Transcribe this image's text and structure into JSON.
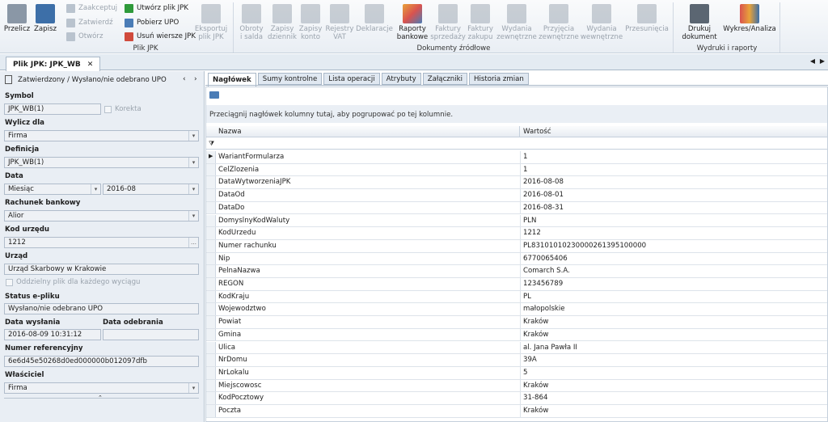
{
  "ribbon": {
    "buttons": [
      {
        "id": "przelicz",
        "label": "Przelicz",
        "enabled": true
      },
      {
        "id": "zapisz",
        "label": "Zapisz",
        "enabled": true
      }
    ],
    "plik_small": {
      "zaakceptuj": "Zaakceptuj",
      "zatwierdz": "Zatwierdź",
      "otworz": "Otwórz",
      "utworz": "Utwórz plik JPK",
      "pobierz": "Pobierz UPO",
      "usun": "Usuń wiersze JPK"
    },
    "eksport": [
      "Eksportuj",
      "plik JPK"
    ],
    "zrodlowe": [
      [
        "Obroty",
        "i salda"
      ],
      [
        "Zapisy",
        "dziennik"
      ],
      [
        "Zapisy",
        "konto"
      ],
      [
        "Rejestry",
        "VAT"
      ],
      [
        "Deklaracje",
        ""
      ],
      [
        "Raporty",
        "bankowe"
      ],
      [
        "Faktury",
        "sprzedaży"
      ],
      [
        "Faktury",
        "zakupu"
      ],
      [
        "Wydania",
        "zewnętrzne"
      ],
      [
        "Przyjęcia",
        "zewnętrzne"
      ],
      [
        "Wydania",
        "wewnętrzne"
      ],
      [
        "Przesunięcia",
        ""
      ]
    ],
    "drukuj": [
      "Drukuj",
      "dokument"
    ],
    "wykres": "Wykres/Analiza",
    "groups": {
      "plik": "Plik JPK",
      "zrodlowe": "Dokumenty źródłowe",
      "wydruki": "Wydruki i raporty"
    }
  },
  "doc_tab": {
    "label": "Plik JPK: JPK_WB",
    "close": "✕"
  },
  "left": {
    "status_header": "Zatwierdzony / Wysłano/nie odebrano UPO",
    "symbol_label": "Symbol",
    "symbol_value": "JPK_WB(1)",
    "korekta": "Korekta",
    "wylicz_label": "Wylicz dla",
    "wylicz_value": "Firma",
    "definicja_label": "Definicja",
    "definicja_value": "JPK_WB(1)",
    "data_label": "Data",
    "data_type": "Miesiąc",
    "data_value": "2016-08",
    "rachunek_label": "Rachunek bankowy",
    "rachunek_value": "Alior",
    "kod_urzedu_label": "Kod urzędu",
    "kod_urzedu_value": "1212",
    "urzad_label": "Urząd",
    "urzad_value": "Urząd Skarbowy w Krakowie",
    "oddzielny": "Oddzielny plik dla każdego wyciągu",
    "status_label": "Status e-pliku",
    "status_value": "Wysłano/nie odebrano UPO",
    "data_wyslania_label": "Data wysłania",
    "data_wyslania_value": "2016-08-09 10:31:12",
    "data_odebrania_label": "Data odebrania",
    "data_odebrania_value": "",
    "numer_label": "Numer referencyjny",
    "numer_value": "6e6d45e50268d0ed000000b012097dfb",
    "wlasciciel_label": "Właściciel",
    "wlasciciel_value": "Firma"
  },
  "tabs": [
    "Nagłówek",
    "Sumy kontrolne",
    "Lista operacji",
    "Atrybuty",
    "Załączniki",
    "Historia zmian"
  ],
  "grid": {
    "group_hint": "Przeciągnij nagłówek kolumny tutaj, aby pogrupować po tej kolumnie.",
    "col_nazwa": "Nazwa",
    "col_wartosc": "Wartość",
    "rows": [
      [
        "WariantFormularza",
        "1"
      ],
      [
        "CelZlozenia",
        "1"
      ],
      [
        "DataWytworzeniaJPK",
        "2016-08-08"
      ],
      [
        "DataOd",
        "2016-08-01"
      ],
      [
        "DataDo",
        "2016-08-31"
      ],
      [
        "DomyslnyKodWaluty",
        "PLN"
      ],
      [
        "KodUrzedu",
        "1212"
      ],
      [
        "Numer rachunku",
        "PL83101010230000261395100000"
      ],
      [
        "Nip",
        "6770065406"
      ],
      [
        "PelnaNazwa",
        "Comarch S.A."
      ],
      [
        "REGON",
        "123456789"
      ],
      [
        "KodKraju",
        "PL"
      ],
      [
        "Wojewodztwo",
        "małopolskie"
      ],
      [
        "Powiat",
        "Kraków"
      ],
      [
        "Gmina",
        "Kraków"
      ],
      [
        "Ulica",
        "al. Jana Pawła II"
      ],
      [
        "NrDomu",
        "39A"
      ],
      [
        "NrLokalu",
        "5"
      ],
      [
        "Miejscowosc",
        "Kraków"
      ],
      [
        "KodPocztowy",
        "31-864"
      ],
      [
        "Poczta",
        "Kraków"
      ]
    ]
  }
}
